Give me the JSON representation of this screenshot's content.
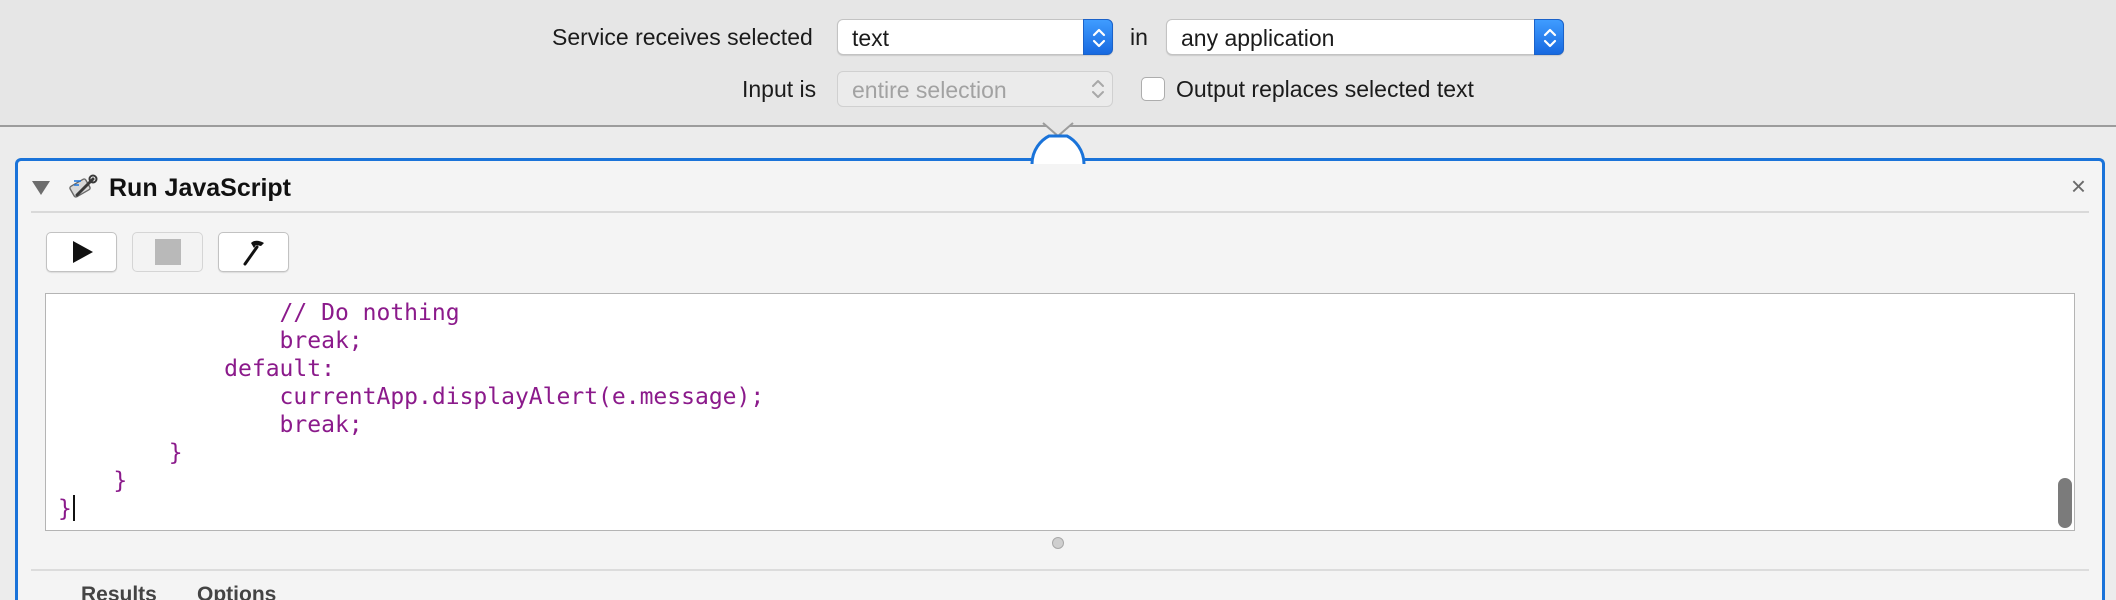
{
  "config": {
    "service_receives_label": "Service receives selected",
    "input_type_value": "text",
    "in_label": "in",
    "application_value": "any application",
    "input_is_label": "Input is",
    "input_is_value": "entire selection",
    "output_replaces_label": "Output replaces selected text",
    "output_replaces_checked": false
  },
  "action": {
    "title": "Run JavaScript",
    "close_symbol": "×",
    "icon": "script-wrench-icon",
    "toolbar": {
      "run_icon": "play-icon",
      "stop_icon": "stop-icon",
      "compile_icon": "hammer-icon"
    },
    "code_lines": [
      "                // Do nothing",
      "                break;",
      "            default:",
      "                currentApp.displayAlert(e.message);",
      "                break;",
      "        }",
      "    }",
      "}"
    ],
    "code_color": "#8b1a8b"
  },
  "bottom_tabs": {
    "results": "Results",
    "options": "Options"
  },
  "colors": {
    "accent": "#1a73d9",
    "background": "#ececec"
  }
}
